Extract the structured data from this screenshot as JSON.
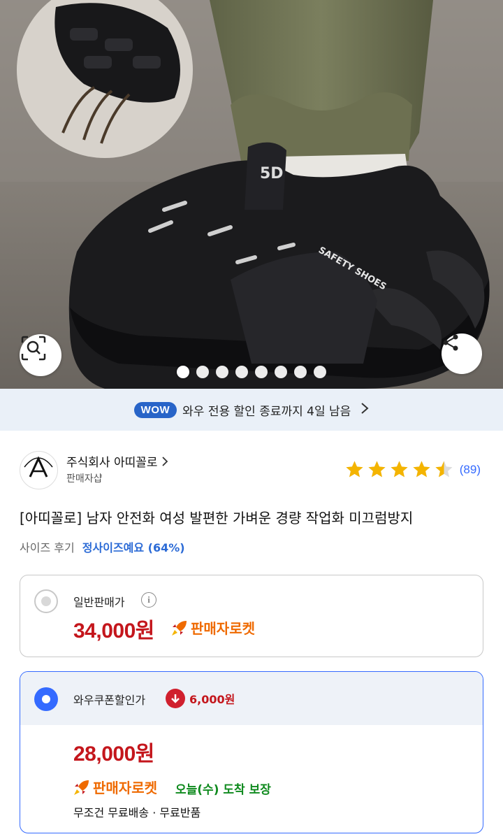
{
  "wow_bar": {
    "badge": "WOW",
    "text": "와우 전용 할인 종료까지 4일 남음"
  },
  "gallery": {
    "dot_count": 8,
    "active_index": 0
  },
  "seller": {
    "name": "주식회사 아띠꼴로",
    "sub": "판매자샵"
  },
  "rating": {
    "stars": 4.5,
    "count": "(89)"
  },
  "product": {
    "title": "[아띠꼴로] 남자 안전화 여성 발편한 가벼운 경량 작업화 미끄럼방지",
    "size_label": "사이즈 후기",
    "size_value": "정사이즈예요 (64%)"
  },
  "prices": {
    "regular_label": "일반판매가",
    "regular_price": "34,000원",
    "rocket_label": "판매자로켓",
    "wow_label": "와우쿠폰할인가",
    "wow_discount": "6,000원",
    "wow_price": "28,000원",
    "arrival": "오늘(수) 도착 보장",
    "shipping": "무조건 무료배송 · 무료반품"
  },
  "colors": {
    "accent_blue": "#346aff",
    "price_red": "#c4161c",
    "rocket_orange": "#ef6a00",
    "star_yellow": "#f4b400",
    "arrival_green": "#0f8a1e"
  }
}
